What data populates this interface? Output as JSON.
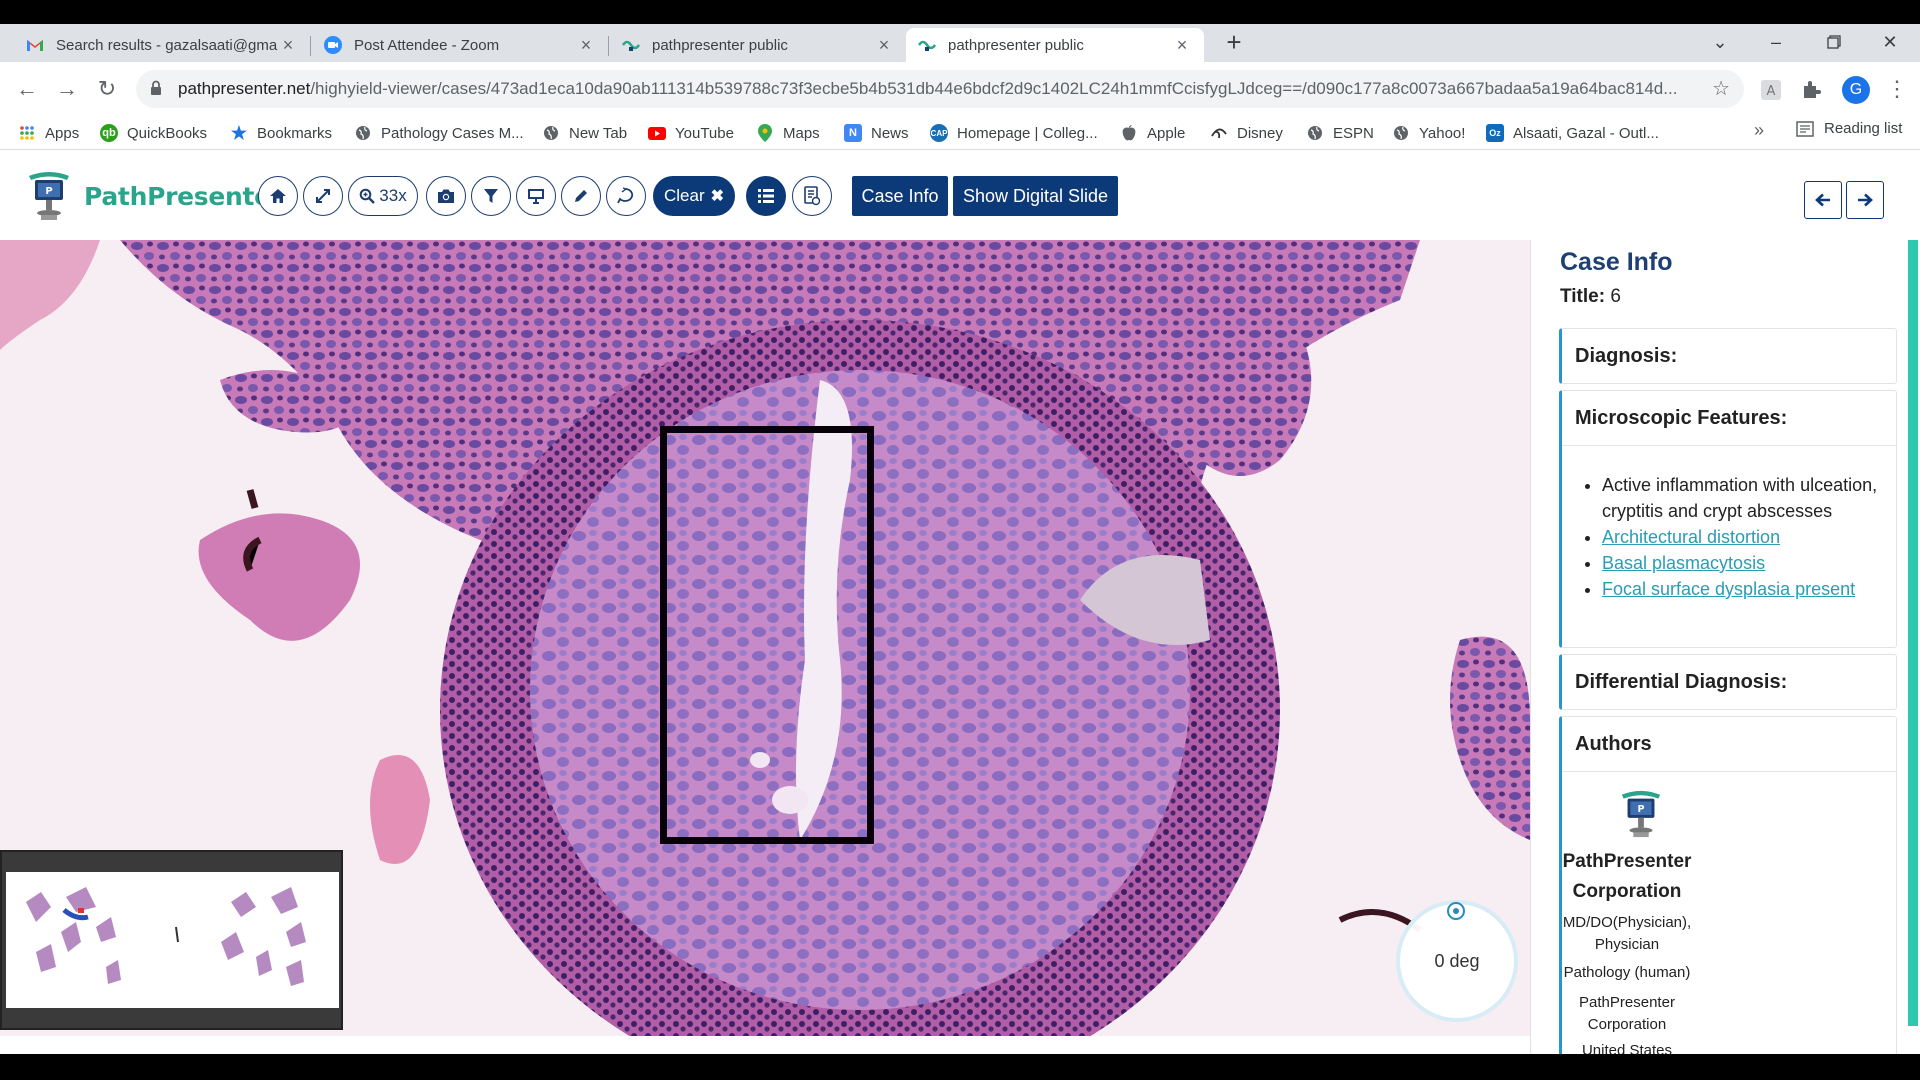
{
  "browser": {
    "tabs": [
      {
        "title": "Search results - gazalsaati@gmail",
        "favicon": "gmail-icon"
      },
      {
        "title": "Post Attendee - Zoom",
        "favicon": "zoom-icon"
      },
      {
        "title": "pathpresenter public",
        "favicon": "pathpresenter-icon"
      },
      {
        "title": "pathpresenter public",
        "favicon": "pathpresenter-icon"
      }
    ],
    "active_tab": 3,
    "url_domain": "pathpresenter.net",
    "url_path": "/highyield-viewer/cases/473ad1eca10da90ab111314b539788c73f3ecbe5b4b531db44e6bdcf2d9c1402LC24h1mmfCcisfygLJdceg==/d090c177a8c0073a667badaa5a19a64bac814d...",
    "profile_initial": "G"
  },
  "bookmarks": [
    {
      "label": "Apps",
      "icon": "apps-grid-icon"
    },
    {
      "label": "QuickBooks",
      "icon": "quickbooks-icon"
    },
    {
      "label": "Bookmarks",
      "icon": "star-icon"
    },
    {
      "label": "Pathology Cases M...",
      "icon": "globe-icon"
    },
    {
      "label": "New Tab",
      "icon": "globe-icon"
    },
    {
      "label": "YouTube",
      "icon": "youtube-icon"
    },
    {
      "label": "Maps",
      "icon": "maps-icon"
    },
    {
      "label": "News",
      "icon": "news-icon"
    },
    {
      "label": "Homepage | Colleg...",
      "icon": "cap-icon"
    },
    {
      "label": "Apple",
      "icon": "apple-icon"
    },
    {
      "label": "Disney",
      "icon": "disney-icon"
    },
    {
      "label": "ESPN",
      "icon": "globe-icon"
    },
    {
      "label": "Yahoo!",
      "icon": "globe-icon"
    },
    {
      "label": "Alsaati, Gazal - Outl...",
      "icon": "outlook-icon"
    }
  ],
  "bookmarks_more": "»",
  "reading_list": "Reading list",
  "app": {
    "logo_text": "PathPresenter",
    "zoom_label": "33x",
    "clear_label": "Clear",
    "case_info_button": "Case Info",
    "show_slide_button": "Show Digital Slide",
    "rotation_label": "0 deg"
  },
  "case_info": {
    "heading": "Case Info",
    "title_key": "Title:",
    "title_value": "6",
    "diagnosis_heading": "Diagnosis:",
    "microscopic_heading": "Microscopic Features:",
    "features": [
      {
        "text": "Active inflammation with ulceation, cryptitis and crypt abscesses",
        "link": false
      },
      {
        "text": "Architectural distortion",
        "link": true
      },
      {
        "text": "Basal plasmacytosis",
        "link": true
      },
      {
        "text": "Focal surface dysplasia present",
        "link": true
      }
    ],
    "differential_heading": "Differential Diagnosis:",
    "authors_heading": "Authors",
    "author": {
      "name": "PathPresenter Corporation",
      "degree": "MD/DO(Physician), Physician",
      "specialty": "Pathology (human)",
      "institution": "PathPresenter Corporation",
      "country": "United States"
    }
  },
  "colors": {
    "brand_green": "#2aa58b",
    "brand_navy": "#0c3a78",
    "link_teal": "#2a9cb3",
    "card_accent": "#2896c8"
  }
}
